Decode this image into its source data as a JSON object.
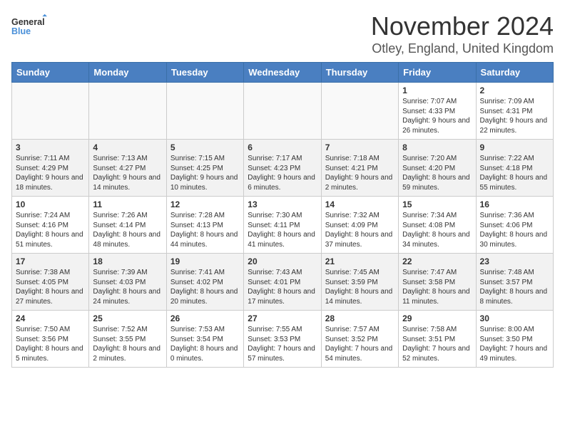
{
  "logo": {
    "text_general": "General",
    "text_blue": "Blue"
  },
  "header": {
    "month_title": "November 2024",
    "location": "Otley, England, United Kingdom"
  },
  "calendar": {
    "days_of_week": [
      "Sunday",
      "Monday",
      "Tuesday",
      "Wednesday",
      "Thursday",
      "Friday",
      "Saturday"
    ],
    "weeks": [
      [
        {
          "day": "",
          "info": ""
        },
        {
          "day": "",
          "info": ""
        },
        {
          "day": "",
          "info": ""
        },
        {
          "day": "",
          "info": ""
        },
        {
          "day": "",
          "info": ""
        },
        {
          "day": "1",
          "info": "Sunrise: 7:07 AM\nSunset: 4:33 PM\nDaylight: 9 hours and 26 minutes."
        },
        {
          "day": "2",
          "info": "Sunrise: 7:09 AM\nSunset: 4:31 PM\nDaylight: 9 hours and 22 minutes."
        }
      ],
      [
        {
          "day": "3",
          "info": "Sunrise: 7:11 AM\nSunset: 4:29 PM\nDaylight: 9 hours and 18 minutes."
        },
        {
          "day": "4",
          "info": "Sunrise: 7:13 AM\nSunset: 4:27 PM\nDaylight: 9 hours and 14 minutes."
        },
        {
          "day": "5",
          "info": "Sunrise: 7:15 AM\nSunset: 4:25 PM\nDaylight: 9 hours and 10 minutes."
        },
        {
          "day": "6",
          "info": "Sunrise: 7:17 AM\nSunset: 4:23 PM\nDaylight: 9 hours and 6 minutes."
        },
        {
          "day": "7",
          "info": "Sunrise: 7:18 AM\nSunset: 4:21 PM\nDaylight: 9 hours and 2 minutes."
        },
        {
          "day": "8",
          "info": "Sunrise: 7:20 AM\nSunset: 4:20 PM\nDaylight: 8 hours and 59 minutes."
        },
        {
          "day": "9",
          "info": "Sunrise: 7:22 AM\nSunset: 4:18 PM\nDaylight: 8 hours and 55 minutes."
        }
      ],
      [
        {
          "day": "10",
          "info": "Sunrise: 7:24 AM\nSunset: 4:16 PM\nDaylight: 8 hours and 51 minutes."
        },
        {
          "day": "11",
          "info": "Sunrise: 7:26 AM\nSunset: 4:14 PM\nDaylight: 8 hours and 48 minutes."
        },
        {
          "day": "12",
          "info": "Sunrise: 7:28 AM\nSunset: 4:13 PM\nDaylight: 8 hours and 44 minutes."
        },
        {
          "day": "13",
          "info": "Sunrise: 7:30 AM\nSunset: 4:11 PM\nDaylight: 8 hours and 41 minutes."
        },
        {
          "day": "14",
          "info": "Sunrise: 7:32 AM\nSunset: 4:09 PM\nDaylight: 8 hours and 37 minutes."
        },
        {
          "day": "15",
          "info": "Sunrise: 7:34 AM\nSunset: 4:08 PM\nDaylight: 8 hours and 34 minutes."
        },
        {
          "day": "16",
          "info": "Sunrise: 7:36 AM\nSunset: 4:06 PM\nDaylight: 8 hours and 30 minutes."
        }
      ],
      [
        {
          "day": "17",
          "info": "Sunrise: 7:38 AM\nSunset: 4:05 PM\nDaylight: 8 hours and 27 minutes."
        },
        {
          "day": "18",
          "info": "Sunrise: 7:39 AM\nSunset: 4:03 PM\nDaylight: 8 hours and 24 minutes."
        },
        {
          "day": "19",
          "info": "Sunrise: 7:41 AM\nSunset: 4:02 PM\nDaylight: 8 hours and 20 minutes."
        },
        {
          "day": "20",
          "info": "Sunrise: 7:43 AM\nSunset: 4:01 PM\nDaylight: 8 hours and 17 minutes."
        },
        {
          "day": "21",
          "info": "Sunrise: 7:45 AM\nSunset: 3:59 PM\nDaylight: 8 hours and 14 minutes."
        },
        {
          "day": "22",
          "info": "Sunrise: 7:47 AM\nSunset: 3:58 PM\nDaylight: 8 hours and 11 minutes."
        },
        {
          "day": "23",
          "info": "Sunrise: 7:48 AM\nSunset: 3:57 PM\nDaylight: 8 hours and 8 minutes."
        }
      ],
      [
        {
          "day": "24",
          "info": "Sunrise: 7:50 AM\nSunset: 3:56 PM\nDaylight: 8 hours and 5 minutes."
        },
        {
          "day": "25",
          "info": "Sunrise: 7:52 AM\nSunset: 3:55 PM\nDaylight: 8 hours and 2 minutes."
        },
        {
          "day": "26",
          "info": "Sunrise: 7:53 AM\nSunset: 3:54 PM\nDaylight: 8 hours and 0 minutes."
        },
        {
          "day": "27",
          "info": "Sunrise: 7:55 AM\nSunset: 3:53 PM\nDaylight: 7 hours and 57 minutes."
        },
        {
          "day": "28",
          "info": "Sunrise: 7:57 AM\nSunset: 3:52 PM\nDaylight: 7 hours and 54 minutes."
        },
        {
          "day": "29",
          "info": "Sunrise: 7:58 AM\nSunset: 3:51 PM\nDaylight: 7 hours and 52 minutes."
        },
        {
          "day": "30",
          "info": "Sunrise: 8:00 AM\nSunset: 3:50 PM\nDaylight: 7 hours and 49 minutes."
        }
      ]
    ]
  }
}
